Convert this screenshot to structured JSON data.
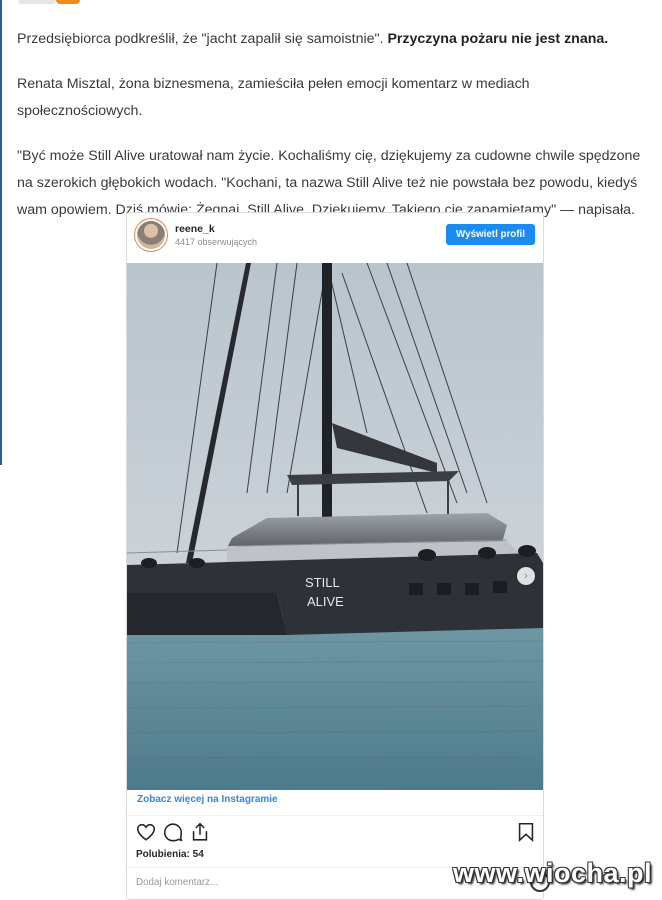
{
  "article": {
    "p1_text": "Przedsiębiorca podkreślił, że \"jacht zapalił się samoistnie\". ",
    "p1_bold": "Przyczyna pożaru nie jest znana.",
    "p2": "Renata Misztal, żona biznesmena, zamieściła pełen emocji komentarz w mediach społecznościowych.",
    "p3": "\"Być może Still Alive uratował nam życie. Kochaliśmy cię, dziękujemy za cudowne chwile spędzone na szerokich głębokich wodach. \"Kochani, ta nazwa Still Alive też nie powstała bez powodu, kiedyś wam opowiem. Dziś mówię: Żegnaj, Still Alive. Dziękujemy. Takiego cię zapamiętamy\" — napisała."
  },
  "instagram": {
    "username": "reene_k",
    "followers": "4417 obserwujących",
    "view_profile_label": "Wyświetl profil",
    "see_more_label": "Zobacz więcej na Instagramie",
    "likes": "Polubienia: 54",
    "comment_placeholder": "Dodaj komentarz...",
    "icons": [
      "heart-icon",
      "comment-icon",
      "share-icon",
      "bookmark-icon",
      "chevron-right-icon"
    ],
    "hull_text_line1": "STILL",
    "hull_text_line2": "ALIVE"
  },
  "watermark": "www.wiocha.pl",
  "colors": {
    "button_blue": "#1a8cef",
    "link_blue": "#3b87d6",
    "hull_dark": "#2e3238",
    "sky": "#c9d3db",
    "sea": "#5f8a9a"
  }
}
